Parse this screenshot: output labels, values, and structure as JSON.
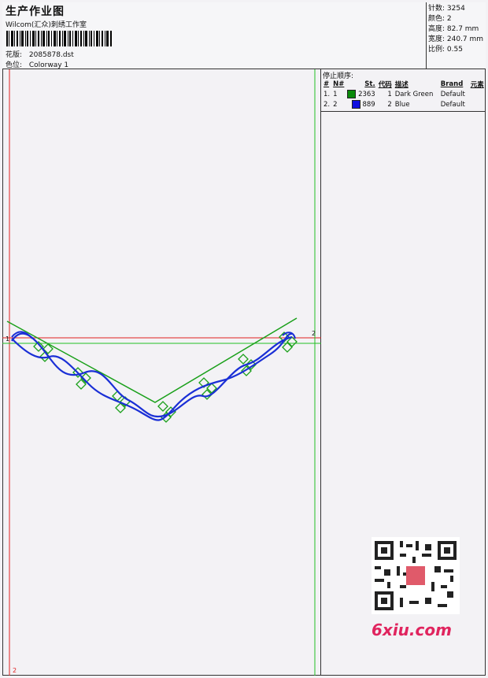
{
  "header": {
    "title": "生产作业图",
    "subtitle": "Wilcom(汇众)刺绣工作室",
    "design_file_label": "花版:",
    "design_file": "2085878.dst",
    "colorway_label": "色位:",
    "colorway": "Colorway 1"
  },
  "stats": {
    "stitches": "针数: 3254",
    "colors": "颜色: 2",
    "height": "高度: 82.7 mm",
    "width": "宽度: 240.7 mm",
    "ratio": "比例: 0.55"
  },
  "stop_sequence": {
    "title": "停止顺序:",
    "columns": [
      "#",
      "N#",
      "St.",
      "代码",
      "描述",
      "Brand",
      "元素"
    ],
    "rows": [
      {
        "num": "1.",
        "needle": "1",
        "color": "#0a8a0a",
        "stitches": "2363",
        "code": "1",
        "description": "Dark Green",
        "brand": "Default"
      },
      {
        "num": "2.",
        "needle": "2",
        "color": "#1010e0",
        "stitches": "889",
        "code": "2",
        "description": "Blue",
        "brand": "Default"
      }
    ]
  },
  "markers": {
    "origin_left": "1",
    "origin_right": "2",
    "bottom_left": "2"
  },
  "colors": {
    "green": "#1aa01a",
    "blue": "#1a2fd6",
    "red_guide": "#e02020",
    "green_guide": "#22c022"
  },
  "watermark": {
    "brand": "6xiu.com"
  }
}
